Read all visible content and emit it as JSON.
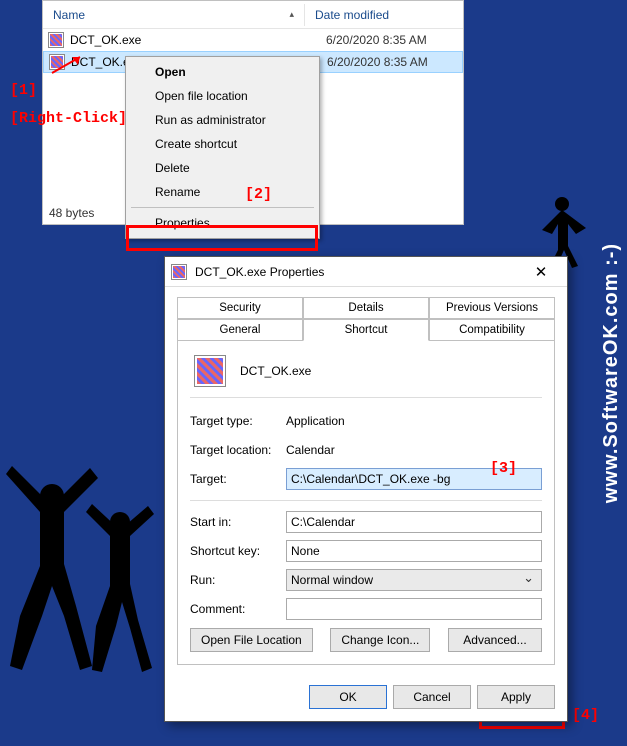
{
  "watermark": "www.SoftwareOK.com :-)",
  "explorer": {
    "col_name": "Name",
    "col_date": "Date modified",
    "rows": [
      {
        "name": "DCT_OK.exe",
        "date": "6/20/2020 8:35 AM"
      },
      {
        "name": "DCT_OK.exe",
        "date": "6/20/2020 8:35 AM"
      }
    ],
    "status": "48 bytes"
  },
  "ctxmenu": {
    "open": "Open",
    "open_loc": "Open file location",
    "run_admin": "Run as administrator",
    "create_shortcut": "Create shortcut",
    "delete": "Delete",
    "rename": "Rename",
    "properties": "Properties"
  },
  "anno": {
    "a1": "[1]",
    "rightclick": "[Right-Click]",
    "a2": "[2]",
    "a3": "[3]",
    "a4": "[4]"
  },
  "dialog": {
    "title": "DCT_OK.exe Properties",
    "tabs": {
      "security": "Security",
      "details": "Details",
      "prev": "Previous Versions",
      "general": "General",
      "shortcut": "Shortcut",
      "compat": "Compatibility"
    },
    "name": "DCT_OK.exe",
    "labels": {
      "target_type": "Target type:",
      "target_loc": "Target location:",
      "target": "Target:",
      "start_in": "Start in:",
      "shortcut_key": "Shortcut key:",
      "run": "Run:",
      "comment": "Comment:"
    },
    "values": {
      "target_type": "Application",
      "target_loc": "Calendar",
      "target": "C:\\Calendar\\DCT_OK.exe -bg",
      "start_in": "C:\\Calendar",
      "shortcut_key": "None",
      "run": "Normal window",
      "comment": ""
    },
    "buttons": {
      "open_file_loc": "Open File Location",
      "change_icon": "Change Icon...",
      "advanced": "Advanced...",
      "ok": "OK",
      "cancel": "Cancel",
      "apply": "Apply"
    }
  }
}
